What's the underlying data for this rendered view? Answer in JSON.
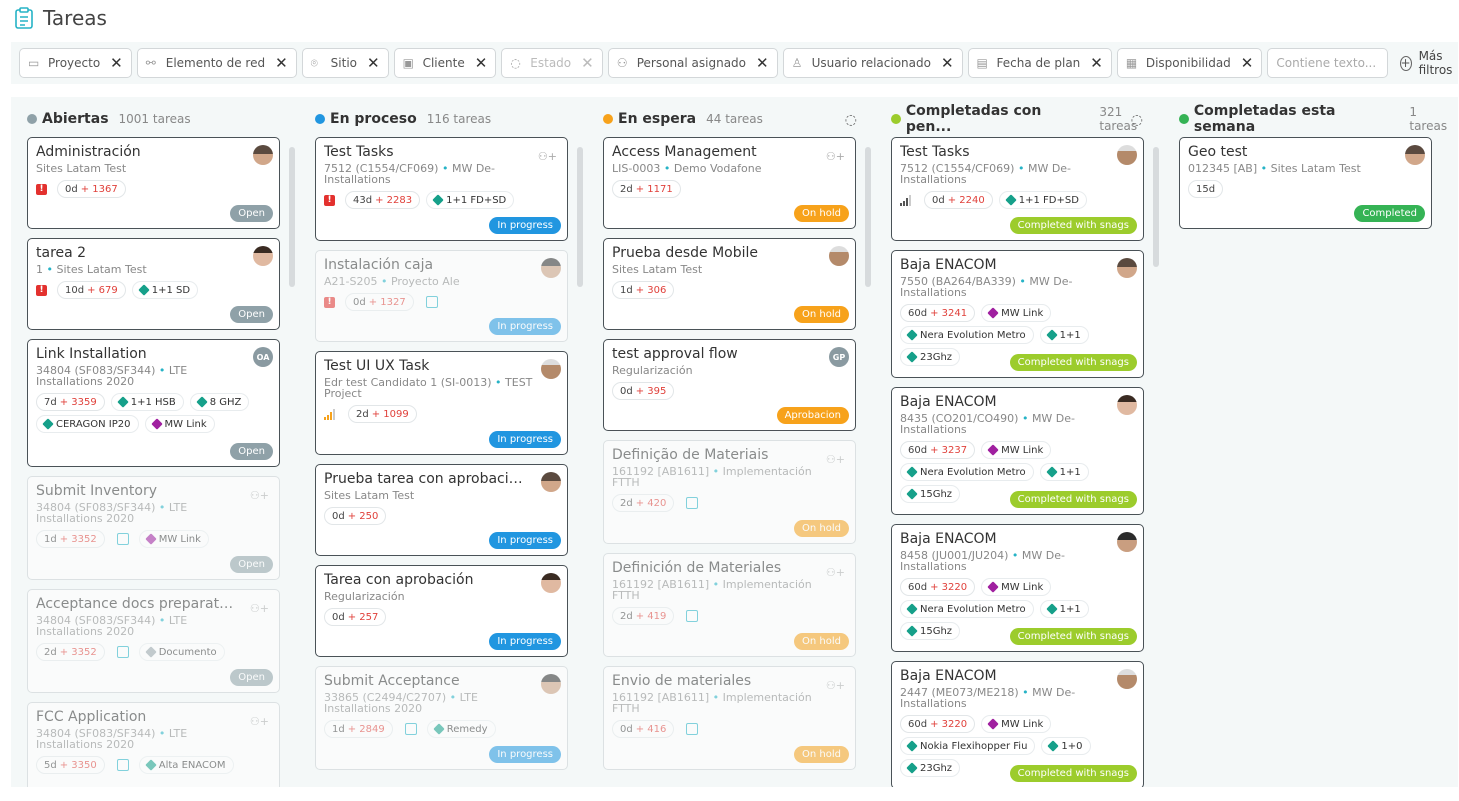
{
  "page": {
    "title": "Tareas"
  },
  "filters": [
    {
      "label": "Proyecto",
      "icon": "folder-icon"
    },
    {
      "label": "Elemento de red",
      "icon": "network-icon"
    },
    {
      "label": "Sitio",
      "icon": "location-pin-icon"
    },
    {
      "label": "Cliente",
      "icon": "briefcase-icon"
    },
    {
      "label": "Estado",
      "icon": "status-circle-icon",
      "disabled": true
    },
    {
      "label": "Personal asignado",
      "icon": "users-icon"
    },
    {
      "label": "Usuario relacionado",
      "icon": "user-icon"
    },
    {
      "label": "Fecha de plan",
      "icon": "calendar-icon"
    },
    {
      "label": "Disponibilidad",
      "icon": "calendar-check-icon"
    }
  ],
  "search": {
    "placeholder": "Contiene texto..."
  },
  "more_filters": "Más filtros",
  "columns": [
    {
      "title": "Abiertas",
      "count": "1001 tareas",
      "color": "#8fa1a8"
    },
    {
      "title": "En proceso",
      "count": "116 tareas",
      "color": "#2196e0"
    },
    {
      "title": "En espera",
      "count": "44 tareas",
      "color": "#f7a21b"
    },
    {
      "title": "Completadas con pen...",
      "count": "321 tareas",
      "color": "#9ccc2c"
    },
    {
      "title": "Completadas esta semana",
      "count": "1 tareas",
      "color": "#35b355"
    }
  ],
  "cards": {
    "c0": [
      {
        "title": "Administración",
        "sub": "Sites Latam Test",
        "days": "0d",
        "extra": "+ 1367",
        "status": "Open"
      },
      {
        "title": "tarea 2",
        "sub_num": "1",
        "sub": "Sites Latam Test",
        "days": "10d",
        "extra": "+ 679",
        "tags": [
          "1+1 SD"
        ],
        "status": "Open"
      },
      {
        "title": "Link Installation",
        "sub_num": "34804 (SF083/SF344)",
        "sub": "LTE Installations 2020",
        "days": "7d",
        "extra": "+ 3359",
        "tags": [
          "1+1 HSB",
          "8 GHZ",
          "CERAGON IP20",
          "MW Link"
        ],
        "status": "Open",
        "avatar": "OA"
      },
      {
        "title": "Submit Inventory",
        "sub_num": "34804 (SF083/SF344)",
        "sub": "LTE Installations 2020",
        "days": "1d",
        "extra": "+ 3352",
        "tags": [
          "MW Link"
        ],
        "status": "Open"
      },
      {
        "title": "Acceptance docs preparation",
        "sub_num": "34804 (SF083/SF344)",
        "sub": "LTE Installations 2020",
        "days": "2d",
        "extra": "+ 3352",
        "tags": [
          "Documento"
        ],
        "status": "Open"
      },
      {
        "title": "FCC Application",
        "sub_num": "34804 (SF083/SF344)",
        "sub": "LTE Installations 2020",
        "days": "5d",
        "extra": "+ 3350",
        "tags": [
          "Alta ENACOM"
        ]
      }
    ],
    "c1": [
      {
        "title": "Test Tasks",
        "sub_num": "7512 (C1554/CF069)",
        "sub": "MW De-Installations",
        "days": "43d",
        "extra": "+ 2283",
        "tags": [
          "1+1 FD+SD"
        ],
        "status": "In progress"
      },
      {
        "title": "Instalación caja",
        "sub_num": "A21-S205",
        "sub": "Proyecto Ale",
        "days": "0d",
        "extra": "+ 1327",
        "status": "In progress"
      },
      {
        "title": "Test UI UX Task",
        "sub_num": "Edr test Candidato 1 (SI-0013)",
        "sub": "TEST Project",
        "days": "2d",
        "extra": "+ 1099",
        "status": "In progress"
      },
      {
        "title": "Prueba tarea con aprobación",
        "sub": "Sites Latam Test",
        "days": "0d",
        "extra": "+ 250",
        "status": "In progress"
      },
      {
        "title": "Tarea con aprobación",
        "sub": "Regularización",
        "days": "0d",
        "extra": "+ 257",
        "status": "In progress"
      },
      {
        "title": "Submit Acceptance",
        "sub_num": "33865 (C2494/C2707)",
        "sub": "LTE Installations 2020",
        "days": "1d",
        "extra": "+ 2849",
        "tags": [
          "Remedy"
        ],
        "status": "In progress"
      }
    ],
    "c2": [
      {
        "title": "Access Management",
        "sub_num": "LIS-0003",
        "sub": "Demo Vodafone",
        "days": "2d",
        "extra": "+ 1171",
        "status": "On hold"
      },
      {
        "title": "Prueba desde Mobile",
        "sub": "Sites Latam Test",
        "days": "1d",
        "extra": "+ 306",
        "status": "On hold"
      },
      {
        "title": "test approval flow",
        "sub": "Regularización",
        "days": "0d",
        "extra": "+ 395",
        "status": "Aprobacion",
        "avatar": "GP"
      },
      {
        "title": "Definição de Materiais",
        "sub_num": "161192 [AB1611]",
        "sub": "Implementación FTTH",
        "days": "2d",
        "extra": "+ 420",
        "status": "On hold"
      },
      {
        "title": "Definición de Materiales",
        "sub_num": "161192 [AB1611]",
        "sub": "Implementación FTTH",
        "days": "2d",
        "extra": "+ 419",
        "status": "On hold"
      },
      {
        "title": "Envio de materiales",
        "sub_num": "161192 [AB1611]",
        "sub": "Implementación FTTH",
        "days": "0d",
        "extra": "+ 416",
        "status": "On hold"
      }
    ],
    "c3": [
      {
        "title": "Test Tasks",
        "sub_num": "7512 (C1554/CF069)",
        "sub": "MW De-Installations",
        "days": "0d",
        "extra": "+ 2240",
        "tags": [
          "1+1 FD+SD"
        ],
        "status": "Completed with snags"
      },
      {
        "title": "Baja ENACOM",
        "sub_num": "7550 (BA264/BA339)",
        "sub": "MW De-Installations",
        "days": "60d",
        "extra": "+ 3241",
        "tags": [
          "MW Link",
          "Nera Evolution Metro",
          "1+1",
          "23Ghz"
        ],
        "status": "Completed with snags"
      },
      {
        "title": "Baja ENACOM",
        "sub_num": "8435 (CO201/CO490)",
        "sub": "MW De-Installations",
        "days": "60d",
        "extra": "+ 3237",
        "tags": [
          "MW Link",
          "Nera Evolution Metro",
          "1+1",
          "15Ghz"
        ],
        "status": "Completed with snags"
      },
      {
        "title": "Baja ENACOM",
        "sub_num": "8458 (JU001/JU204)",
        "sub": "MW De-Installations",
        "days": "60d",
        "extra": "+ 3220",
        "tags": [
          "MW Link",
          "Nera Evolution Metro",
          "1+1",
          "15Ghz"
        ],
        "status": "Completed with snags"
      },
      {
        "title": "Baja ENACOM",
        "sub_num": "2447 (ME073/ME218)",
        "sub": "MW De-Installations",
        "days": "60d",
        "extra": "+ 3220",
        "tags": [
          "MW Link",
          "Nokia Flexihopper Fiu",
          "1+0",
          "23Ghz"
        ],
        "status": "Completed with snags"
      }
    ],
    "c4": [
      {
        "title": "Geo test",
        "sub_num": "012345 [AB]",
        "sub": "Sites Latam Test",
        "days": "15d",
        "status": "Completed"
      }
    ]
  }
}
